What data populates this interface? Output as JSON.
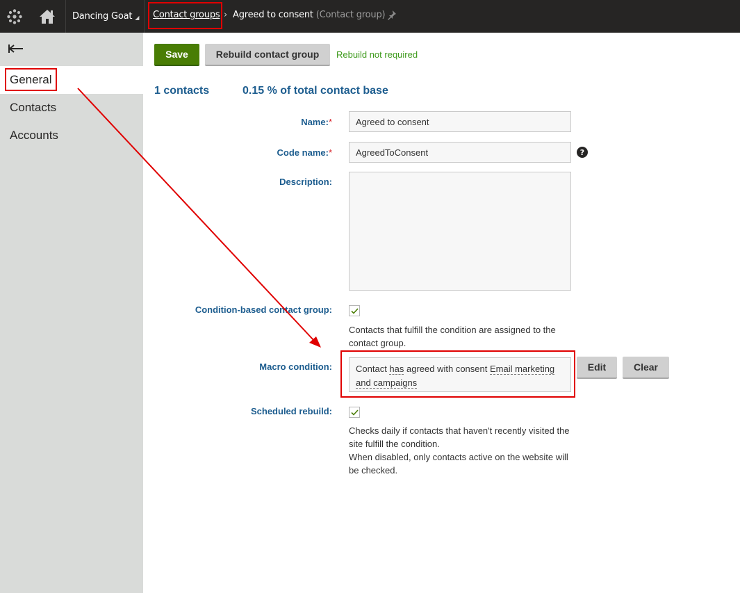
{
  "topbar": {
    "logo_icon": "kentico-logo-icon",
    "home_icon": "home-icon",
    "site_name": "Dancing Goat",
    "breadcrumb_link": "Contact groups",
    "breadcrumb_sep": "›",
    "breadcrumb_current": "Agreed to consent",
    "breadcrumb_type": "(Contact group)",
    "pin_icon": "pin-icon"
  },
  "sidebar": {
    "back_icon": "back-arrow-icon",
    "items": [
      {
        "label": "General",
        "active": true
      },
      {
        "label": "Contacts",
        "active": false
      },
      {
        "label": "Accounts",
        "active": false
      }
    ]
  },
  "toolbar": {
    "save_label": "Save",
    "rebuild_label": "Rebuild contact group",
    "rebuild_status": "Rebuild not required"
  },
  "stats": {
    "contacts": "1 contacts",
    "share": "0.15 % of total contact base"
  },
  "form": {
    "name_label": "Name:",
    "name_value": "Agreed to consent",
    "code_label": "Code name:",
    "code_value": "AgreedToConsent",
    "required_mark": "*",
    "help_glyph": "?",
    "description_label": "Description:",
    "description_value": "",
    "condition_label": "Condition-based contact group:",
    "condition_checked": true,
    "condition_text": "Contacts that fulfill the condition are assigned to the contact group.",
    "macro_label": "Macro condition:",
    "macro_part1": "Contact ",
    "macro_part2": "has",
    "macro_part3": " agreed with consent ",
    "macro_part4": "Email marketing and campaigns",
    "edit_label": "Edit",
    "clear_label": "Clear",
    "scheduled_label": "Scheduled rebuild:",
    "scheduled_checked": true,
    "scheduled_text1": "Checks daily if contacts that haven't recently visited the site fulfill the condition.",
    "scheduled_text2": "When disabled, only contacts active on the website will be checked."
  },
  "colors": {
    "topbar": "#262524",
    "sidebar": "#d9dbd9",
    "label_blue": "#1d5d8f",
    "save_green": "#497d04",
    "status_green": "#3d9a1b",
    "annotation_red": "#e00000"
  }
}
